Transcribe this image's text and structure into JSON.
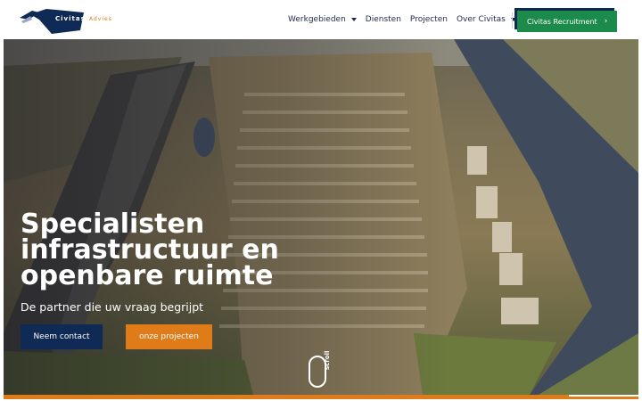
{
  "brand": {
    "name": "Civitas",
    "sub": "Advies",
    "colors": {
      "navy": "#0f2a55",
      "orange": "#e07b1a",
      "green": "#1b8a4a"
    }
  },
  "nav": {
    "items": [
      {
        "label": "Werkgebieden",
        "dropdown": true
      },
      {
        "label": "Diensten",
        "dropdown": false
      },
      {
        "label": "Projecten",
        "dropdown": false
      },
      {
        "label": "Over Civitas",
        "dropdown": true
      }
    ],
    "cta_label": "Civitas Recruitment"
  },
  "hero": {
    "title_lines": [
      "Specialisten",
      "infrastructuur en",
      "openbare ruimte"
    ],
    "subtitle": "De partner die uw vraag begrijpt",
    "primary_label": "Neem contact",
    "secondary_label": "onze projecten",
    "scroll_label": "scroll",
    "image": "aerial-photo-residential-district-canal"
  }
}
